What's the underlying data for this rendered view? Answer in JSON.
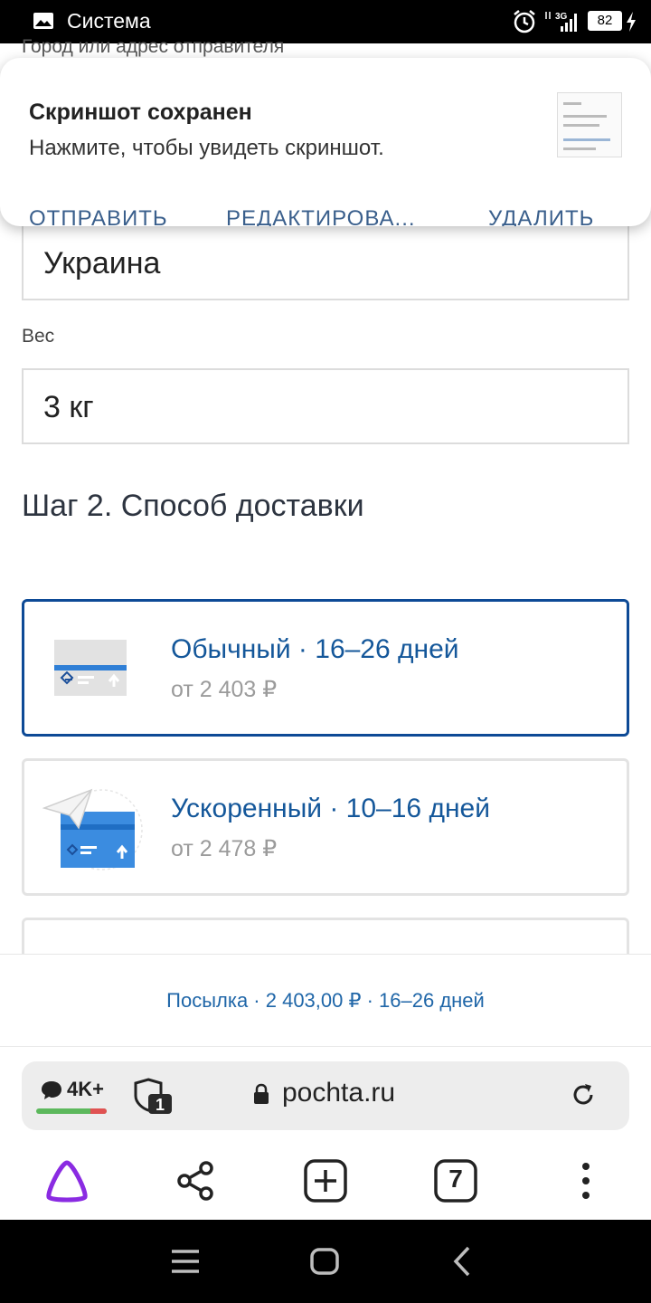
{
  "status_bar": {
    "title": "Система",
    "network": "3G",
    "battery": "82"
  },
  "partial_label": "Город или адрес отправителя",
  "notification": {
    "title": "Скриншот сохранен",
    "text": "Нажмите, чтобы увидеть скриншот.",
    "actions": [
      "ОТПРАВИТЬ",
      "РЕДАКТИРОВА...",
      "УДАЛИТЬ"
    ]
  },
  "form": {
    "country_value": "Украина",
    "weight_label": "Вес",
    "weight_value": "3 кг"
  },
  "step2": {
    "title": "Шаг 2. Способ доставки"
  },
  "delivery_options": [
    {
      "title": "Обычный · 16–26 дней",
      "price": "от 2 403 ₽",
      "selected": true
    },
    {
      "title": "Ускоренный · 10–16 дней",
      "price": "от 2 478 ₽",
      "selected": false
    }
  ],
  "summary": {
    "text": "Посылка  · 2 403,00 ₽  · 16–26 дней"
  },
  "browser": {
    "comments_count": "4K+",
    "shield_badge": "1",
    "url": "pochta.ru",
    "tabs_count": "7"
  },
  "colors": {
    "accent_blue": "#14579a",
    "selected_border": "#0d4a96",
    "alice_purple": "#8a2be2"
  }
}
